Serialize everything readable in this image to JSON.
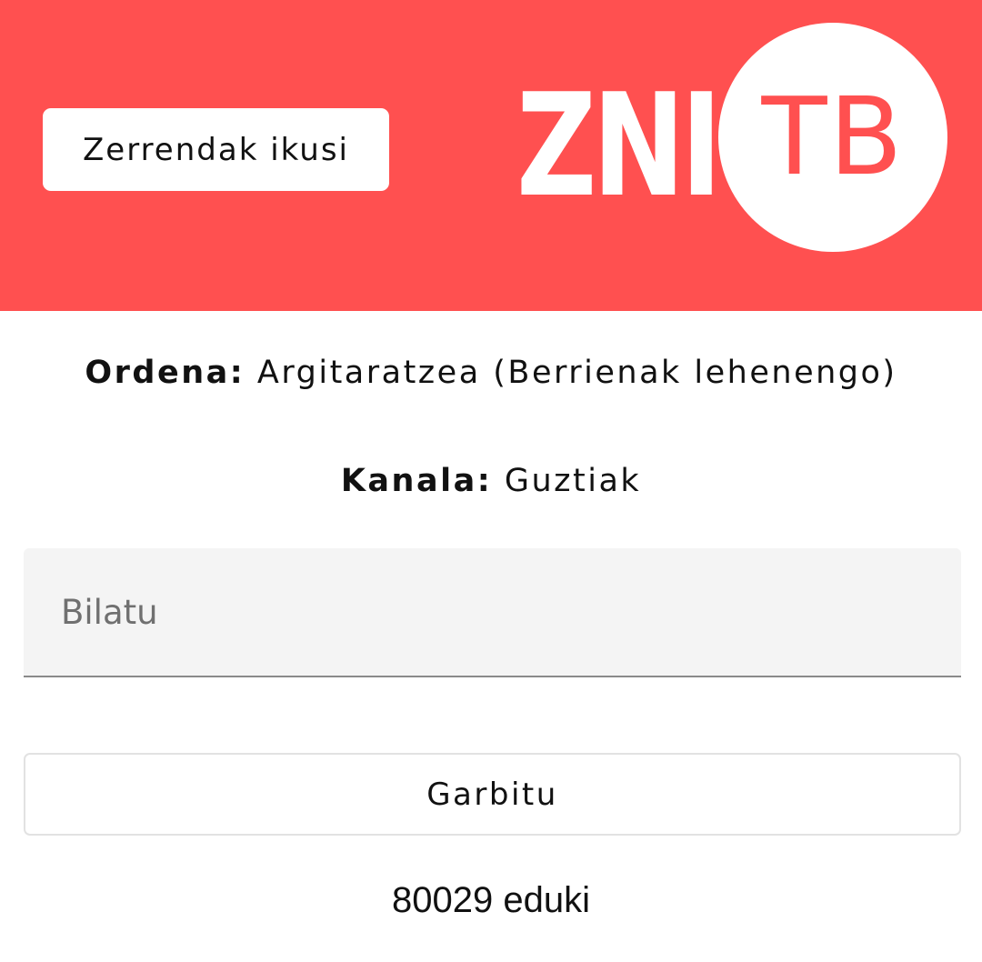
{
  "header": {
    "lists_button_label": "Zerrendak ikusi",
    "logo": {
      "left_text": "ZNI",
      "circle_text": "TB"
    },
    "background_color": "#ff5050"
  },
  "filters": {
    "order_label": "Ordena:",
    "order_value": "Argitaratzea (Berrienak lehenengo)",
    "channel_label": "Kanala:",
    "channel_value": "Guztiak"
  },
  "search": {
    "placeholder": "Bilatu",
    "value": ""
  },
  "clear_button_label": "Garbitu",
  "results": {
    "count_text": "80029 eduki"
  }
}
